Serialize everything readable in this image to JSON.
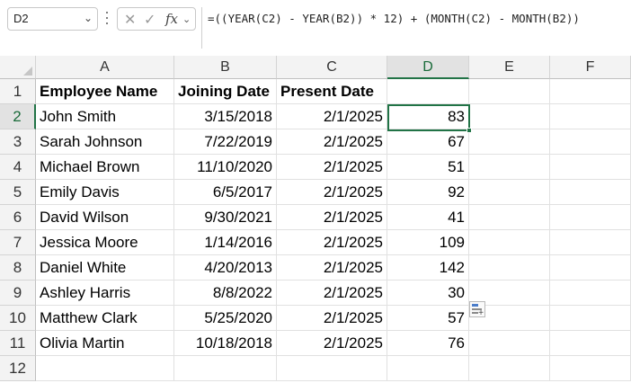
{
  "formula_bar": {
    "name_box": "D2",
    "name_box_caret": "⌄",
    "cancel_glyph": "✕",
    "enter_glyph": "✓",
    "fx_label": "fx",
    "fx_caret": "⌄",
    "formula": "=((YEAR(C2) - YEAR(B2)) * 12) + (MONTH(C2) - MONTH(B2))"
  },
  "columns": [
    "A",
    "B",
    "C",
    "D",
    "E",
    "F"
  ],
  "active_column": "D",
  "active_row": "2",
  "rows": [
    {
      "num": "1",
      "a": "Employee Name",
      "b": "Joining Date",
      "c": "Present Date",
      "d": ""
    },
    {
      "num": "2",
      "a": "John Smith",
      "b": "3/15/2018",
      "c": "2/1/2025",
      "d": "83"
    },
    {
      "num": "3",
      "a": "Sarah Johnson",
      "b": "7/22/2019",
      "c": "2/1/2025",
      "d": "67"
    },
    {
      "num": "4",
      "a": "Michael Brown",
      "b": "11/10/2020",
      "c": "2/1/2025",
      "d": "51"
    },
    {
      "num": "5",
      "a": "Emily Davis",
      "b": "6/5/2017",
      "c": "2/1/2025",
      "d": "92"
    },
    {
      "num": "6",
      "a": "David Wilson",
      "b": "9/30/2021",
      "c": "2/1/2025",
      "d": "41"
    },
    {
      "num": "7",
      "a": "Jessica Moore",
      "b": "1/14/2016",
      "c": "2/1/2025",
      "d": "109"
    },
    {
      "num": "8",
      "a": "Daniel White",
      "b": "4/20/2013",
      "c": "2/1/2025",
      "d": "142"
    },
    {
      "num": "9",
      "a": "Ashley Harris",
      "b": "8/8/2022",
      "c": "2/1/2025",
      "d": "30"
    },
    {
      "num": "10",
      "a": "Matthew Clark",
      "b": "5/25/2020",
      "c": "2/1/2025",
      "d": "57"
    },
    {
      "num": "11",
      "a": "Olivia Martin",
      "b": "10/18/2018",
      "c": "2/1/2025",
      "d": "76"
    },
    {
      "num": "12",
      "a": "",
      "b": "",
      "c": "",
      "d": ""
    }
  ],
  "colors": {
    "accent": "#217346"
  }
}
